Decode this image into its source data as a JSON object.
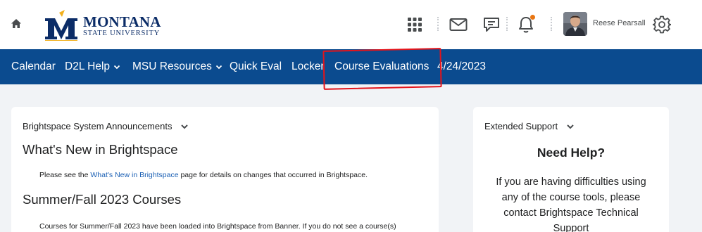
{
  "header": {
    "logo": {
      "line1": "MONTANA",
      "line2": "STATE UNIVERSITY"
    },
    "icons": [
      "home-icon",
      "apps-grid-icon",
      "mail-icon",
      "chat-icon",
      "bell-icon",
      "settings-gear-icon"
    ],
    "user_name": "Reese Pearsall",
    "notification_dot_color": "#e87511"
  },
  "nav": {
    "items": [
      {
        "label": "Calendar",
        "dropdown": false
      },
      {
        "label": "D2L Help",
        "dropdown": true
      },
      {
        "label": "MSU Resources",
        "dropdown": true
      },
      {
        "label": "Quick Eval",
        "dropdown": false
      },
      {
        "label": "Locker",
        "dropdown": false
      },
      {
        "label": "Course Evaluations",
        "dropdown": false
      },
      {
        "label": "4/24/2023",
        "dropdown": false
      }
    ],
    "bg_color": "#0b4b8f"
  },
  "annotation_color": "#e3141b",
  "announcements": {
    "widget_title": "Brightspace System Announcements",
    "items": [
      {
        "heading": "What's New in Brightspace",
        "text_before": "Please see the ",
        "link": "What's New in Brightspace",
        "text_after": " page for details on changes that occurred in Brightspace."
      },
      {
        "heading": "Summer/Fall 2023 Courses",
        "text": "Courses for Summer/Fall 2023 have been loaded into Brightspace from Banner. If you do not see a course(s)"
      }
    ]
  },
  "support": {
    "widget_title": "Extended Support",
    "heading": "Need Help?",
    "text": "If you are having difficulties using any of the course tools, please contact Brightspace Technical Support"
  }
}
